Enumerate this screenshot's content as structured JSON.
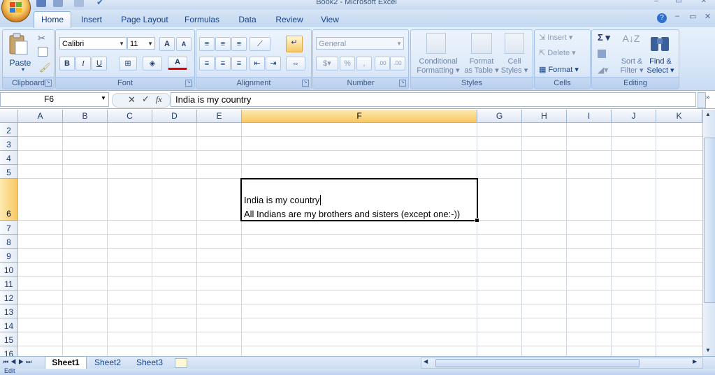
{
  "window": {
    "title": "Book2 - Microsoft Excel"
  },
  "tabs": [
    "Home",
    "Insert",
    "Page Layout",
    "Formulas",
    "Data",
    "Review",
    "View"
  ],
  "ribbon": {
    "clipboard": {
      "paste": "Paste",
      "label": "Clipboard"
    },
    "font": {
      "name": "Calibri",
      "size": "11",
      "bold": "B",
      "italic": "I",
      "underline": "U",
      "grow": "A",
      "shrink": "A",
      "color": "A",
      "label": "Font"
    },
    "alignment": {
      "label": "Alignment"
    },
    "number": {
      "format": "General",
      "percent": "%",
      "comma": ",",
      "inc": ".00",
      "dec": ".00",
      "label": "Number"
    },
    "styles": {
      "conditional1": "Conditional",
      "conditional2": "Formatting",
      "format1": "Format",
      "format2": "as Table",
      "cell1": "Cell",
      "cell2": "Styles",
      "label": "Styles"
    },
    "cells": {
      "insert": "Insert",
      "delete": "Delete",
      "format": "Format",
      "label": "Cells"
    },
    "editing": {
      "sum": "Σ",
      "sort1": "Sort &",
      "sort2": "Filter",
      "find1": "Find &",
      "find2": "Select",
      "label": "Editing"
    }
  },
  "formula_bar": {
    "name_box": "F6",
    "fx": "fx",
    "content": "India is my country"
  },
  "columns": [
    "A",
    "B",
    "C",
    "D",
    "E",
    "F",
    "G",
    "H",
    "I",
    "J",
    "K"
  ],
  "rows": [
    "2",
    "3",
    "4",
    "5",
    "6",
    "7",
    "8",
    "9",
    "10",
    "11",
    "12",
    "13",
    "14",
    "15",
    "16"
  ],
  "active_cell": {
    "ref": "F6",
    "line1": "India is my country",
    "line2": "All Indians are my brothers and sisters (except one:-))"
  },
  "sheets": [
    "Sheet1",
    "Sheet2",
    "Sheet3"
  ],
  "status": {
    "mode": "Edit"
  },
  "colors": {
    "accent": "#15428b",
    "selected_header": "#f8c863"
  }
}
